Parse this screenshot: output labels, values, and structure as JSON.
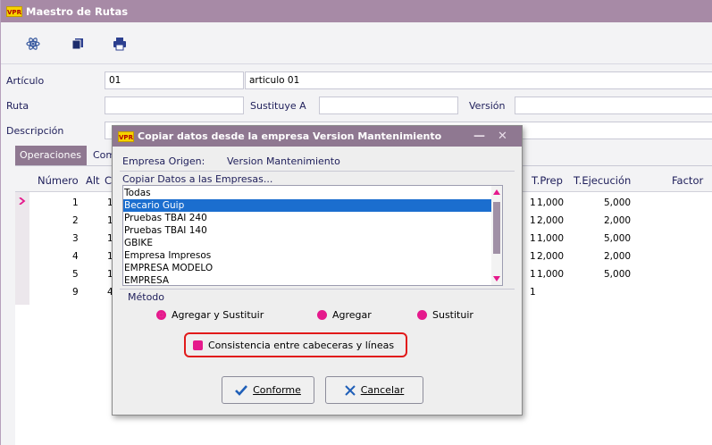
{
  "window": {
    "app_badge": "VPR",
    "title": "Maestro de Rutas"
  },
  "form": {
    "articulo_label": "Artículo",
    "articulo_code": "01",
    "articulo_name": "articulo 01",
    "ruta_label": "Ruta",
    "ruta_value": "",
    "sustituye_label": "Sustituye A",
    "sustituye_value": "",
    "version_label": "Versión",
    "version_value": "",
    "descripcion_label": "Descripción"
  },
  "tabs": [
    {
      "label": "Operaciones"
    },
    {
      "label": "Com"
    }
  ],
  "grid": {
    "headers": {
      "numero": "Número",
      "alt": "Alt",
      "c": "C",
      "tprep": "T.Prep",
      "tejec": "T.Ejecución",
      "factor": "Factor"
    },
    "rows": [
      {
        "numero": "1",
        "alt": "1",
        "m": "1",
        "tprep": "1,000",
        "tejec": "5,000"
      },
      {
        "numero": "2",
        "alt": "1",
        "m": "1",
        "tprep": "2,000",
        "tejec": "2,000"
      },
      {
        "numero": "3",
        "alt": "1",
        "m": "1",
        "tprep": "1,000",
        "tejec": "5,000"
      },
      {
        "numero": "4",
        "alt": "1",
        "m": "1",
        "tprep": "2,000",
        "tejec": "2,000"
      },
      {
        "numero": "5",
        "alt": "1",
        "m": "1",
        "tprep": "1,000",
        "tejec": "5,000"
      },
      {
        "numero": "9",
        "alt": "4",
        "m": "1",
        "tprep": "",
        "tejec": ""
      }
    ]
  },
  "dialog": {
    "badge": "VPR",
    "title": "Copiar datos desde la empresa Version Mantenimiento",
    "minimize": "—",
    "close": "✕",
    "origen_label": "Empresa Origen:",
    "origen_value": "Version Mantenimiento",
    "copiar_label": "Copiar Datos a las Empresas...",
    "empresas": [
      "Todas",
      "Becario Guip",
      "Pruebas TBAI 240",
      "Pruebas TBAI 140",
      "GBIKE",
      "Empresa Impresos",
      "EMPRESA MODELO",
      "EMPRESA"
    ],
    "selected_index": 1,
    "metodo_label": "Método",
    "options": [
      "Agregar y Sustituir",
      "Agregar",
      "Sustituir"
    ],
    "selected_option": 0,
    "consistencia_label": "Consistencia entre cabeceras y líneas",
    "conforme_label": "Conforme",
    "cancelar_label": "Cancelar"
  },
  "colors": {
    "titlebar": "#a78aa6",
    "dialog_titlebar": "#8f7891",
    "accent": "#e5198c",
    "selection": "#1b6ecf",
    "highlight": "#e11a1a"
  }
}
